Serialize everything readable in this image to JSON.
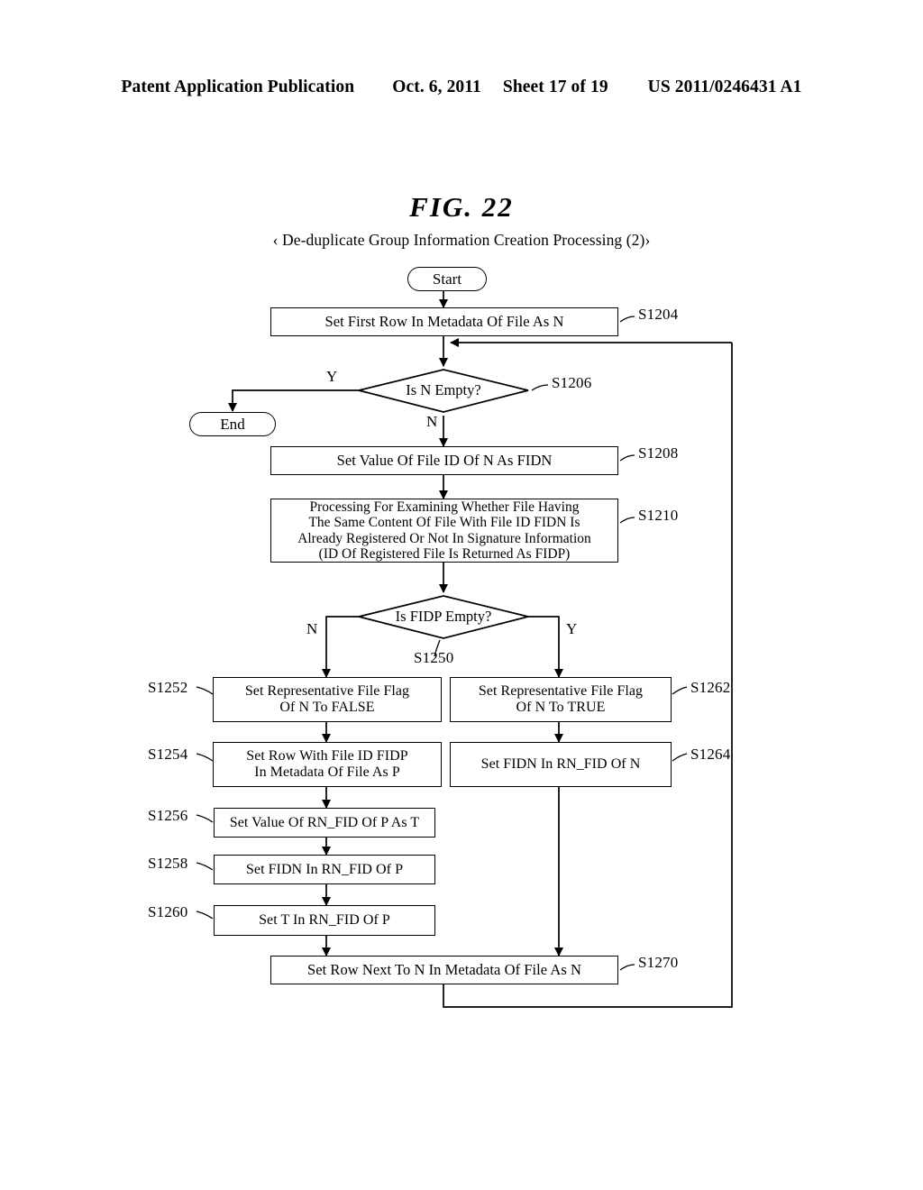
{
  "header": {
    "publication": "Patent Application Publication",
    "date": "Oct. 6, 2011",
    "sheet": "Sheet 17 of 19",
    "number": "US 2011/0246431 A1"
  },
  "figure": {
    "title": "FIG.  22",
    "subtitle": "‹ De-duplicate Group Information Creation Processing (2)›"
  },
  "flowchart": {
    "nodes": {
      "start": {
        "label": "Start",
        "type": "terminator"
      },
      "end": {
        "label": "End",
        "type": "terminator"
      },
      "s1204": {
        "label": "Set First Row In Metadata Of File As N",
        "ref": "S1204",
        "type": "process"
      },
      "s1206": {
        "label": "Is N Empty?",
        "ref": "S1206",
        "type": "decision"
      },
      "s1208": {
        "label": "Set Value Of File ID Of N As FIDN",
        "ref": "S1208",
        "type": "process"
      },
      "s1210": {
        "line1": "Processing For Examining Whether File Having",
        "line2": "The Same Content Of File With File ID FIDN Is",
        "line3": "Already Registered Or Not In Signature Information",
        "line4": "(ID Of Registered File Is Returned As FIDP)",
        "ref": "S1210",
        "type": "process"
      },
      "s1250": {
        "label": "Is FIDP Empty?",
        "ref": "S1250",
        "type": "decision"
      },
      "s1252": {
        "line1": "Set Representative File Flag",
        "line2": "Of N To FALSE",
        "ref": "S1252",
        "type": "process"
      },
      "s1254": {
        "line1": "Set Row With File ID FIDP",
        "line2": "In Metadata Of File As P",
        "ref": "S1254",
        "type": "process"
      },
      "s1256": {
        "label": "Set Value Of RN_FID Of P As T",
        "ref": "S1256",
        "type": "process"
      },
      "s1258": {
        "label": "Set FIDN In RN_FID Of P",
        "ref": "S1258",
        "type": "process"
      },
      "s1260": {
        "label": "Set T In RN_FID Of P",
        "ref": "S1260",
        "type": "process"
      },
      "s1262": {
        "line1": "Set Representative File Flag",
        "line2": "Of N To TRUE",
        "ref": "S1262",
        "type": "process"
      },
      "s1264": {
        "label": "Set FIDN In RN_FID Of N",
        "ref": "S1264",
        "type": "process"
      },
      "s1270": {
        "label": "Set Row Next To N In Metadata Of File As N",
        "ref": "S1270",
        "type": "process"
      }
    },
    "branches": {
      "s1206_yes": "Y",
      "s1206_no": "N",
      "s1250_no": "N",
      "s1250_yes": "Y"
    },
    "colors": {
      "line": "#000000",
      "node_fill": "#ffffff",
      "text": "#000000"
    }
  }
}
